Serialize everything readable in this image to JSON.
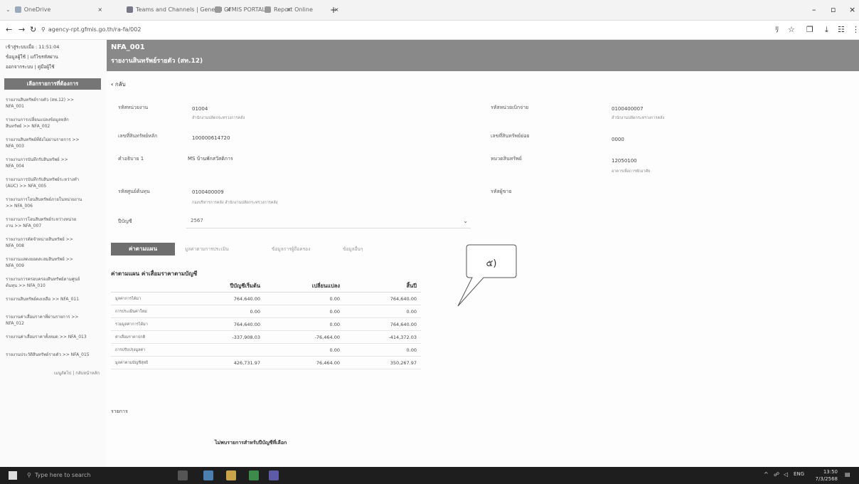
{
  "browser": {
    "tabs": [
      {
        "label": "OneDrive"
      },
      {
        "label": "Teams and Channels | General"
      },
      {
        "label": "GFMIS PORTAL"
      },
      {
        "label": "Report Online"
      }
    ],
    "url": "agency-rpt.gfmis.go.th/ra-fa/002"
  },
  "sidebar": {
    "top_lines": [
      "เข้าสู่ระบบเมื่อ : 11:51:04",
      "ข้อมูลผู้ใช้ | แก้ไขรหัสผ่าน",
      "ออกจากระบบ | คู่มือผู้ใช้"
    ],
    "menu_header": "เลือกรายการที่ต้องการ",
    "items": [
      {
        "line1": "รายงานสินทรัพย์รายตัว (สท.12) >>",
        "line2": "NFA_001"
      },
      {
        "line1": "รายงานการเปลี่ยนแปลงข้อมูลหลัก",
        "line2": "สินทรัพย์ >> NFA_002"
      },
      {
        "line1": "รายงานสินทรัพย์ที่ยังไม่ผ่านรายการ >>",
        "line2": "NFA_003"
      },
      {
        "line1": "รายงานการบันทึกรับสินทรัพย์ >>",
        "line2": "NFA_004"
      },
      {
        "line1": "รายงานการบันทึกรับสินทรัพย์ระหว่างทำ",
        "line2": "(AUC) >> NFA_005"
      },
      {
        "line1": "รายงานการโอนสินทรัพย์ภายในหน่วยงาน",
        "line2": ">> NFA_006"
      },
      {
        "line1": "รายงานการโอนสินทรัพย์ระหว่างหน่วย",
        "line2": "งาน >> NFA_007"
      },
      {
        "line1": "รายงานการตัดจำหน่ายสินทรัพย์ >>",
        "line2": "NFA_008"
      },
      {
        "line1": "รายงานแสดงยอดสะสมสินทรัพย์ >>",
        "line2": "NFA_009"
      },
      {
        "line1": "รายงานการครอบครองสินทรัพย์ตามศูนย์",
        "line2": "ต้นทุน >> NFA_010"
      },
      {
        "line1": "รายงานสินทรัพย์คงเหลือ >> NFA_011",
        "line2": ""
      },
      {
        "line1": "รายงานค่าเสื่อมราคาที่ผ่านรายการ >>",
        "line2": "NFA_012"
      },
      {
        "line1": "รายงานค่าเสื่อมราคาทั้งหมด >> NFA_013",
        "line2": ""
      },
      {
        "line1": "รายงานประวัติสินทรัพย์รายตัว >> NFA_015",
        "line2": ""
      }
    ],
    "footer": "เมนูถัดไป | กลับหน้าหลัก"
  },
  "header": {
    "code": "NFA_001",
    "title": "รายงานสินทรัพย์รายตัว (สท.12)"
  },
  "back_label": "กลับ",
  "form": {
    "left": [
      {
        "label": "รหัสหน่วยงาน",
        "value": "01004",
        "sub": "สำนักงานปลัดกระทรวงการคลัง"
      },
      {
        "label": "เลขที่สินทรัพย์หลัก",
        "value": "100000614720",
        "sub": ""
      },
      {
        "label": "คำอธิบาย 1",
        "value": "MS บ้านพักสวัสดิการ",
        "sub": ""
      },
      {
        "label": "รหัสศูนย์ต้นทุน",
        "value": "0100400009",
        "sub": "กองบริหารการคลัง สำนักงานปลัดกระทรวงการคลัง"
      }
    ],
    "right": [
      {
        "label": "รหัสหน่วยเบิกจ่าย",
        "value": "0100400007",
        "sub": "สำนักงานปลัดกระทรวงการคลัง"
      },
      {
        "label": "เลขที่สินทรัพย์ย่อย",
        "value": "0000",
        "sub": ""
      },
      {
        "label": "หมวดสินทรัพย์",
        "value": "12050100",
        "sub": "อาคารเพื่อการพักอาศัย"
      },
      {
        "label": "รหัสผู้ขาย",
        "value": "",
        "sub": ""
      }
    ],
    "year_label": "ปีบัญชี",
    "year_value": "2567"
  },
  "tabs": [
    {
      "label": "ค่าตามแผน"
    },
    {
      "label": "มูลค่าตามการประเมิน"
    },
    {
      "label": "ข้อมูลการผู้ถือครอง"
    },
    {
      "label": "ข้อมูลอื่นๆ"
    }
  ],
  "section_title": "ค่าตามแผน ค่าเสื่อมราคาตามบัญชี",
  "table": {
    "headers": [
      "",
      "ปีบัญชีเริ่มต้น",
      "เปลี่ยนแปลง",
      "สิ้นปี"
    ],
    "rows": [
      [
        "มูลค่าการได้มา",
        "764,640.00",
        "0.00",
        "764,640.00"
      ],
      [
        "การประเมินค่าใหม่",
        "0.00",
        "0.00",
        "0.00"
      ],
      [
        "รวมมูลค่าการได้มา",
        "764,640.00",
        "0.00",
        "764,640.00"
      ],
      [
        "ค่าเสื่อมราคาปกติ",
        "-337,908.03",
        "-76,464.00",
        "-414,372.03"
      ],
      [
        "การปรับปรุงมูลค่า",
        "",
        "0.00",
        "0.00"
      ],
      [
        "มูลค่าตามบัญชีสุทธิ",
        "426,731.97",
        "76,464.00",
        "350,267.97"
      ]
    ]
  },
  "items_label": "รายการ",
  "empty_message": "ไม่พบรายการสำหรับปีบัญชีที่เลือก",
  "callout_text": "๕)",
  "taskbar": {
    "search_placeholder": "Type here to search",
    "lang": "ENG",
    "time": "13:50",
    "date": "7/3/2568"
  }
}
